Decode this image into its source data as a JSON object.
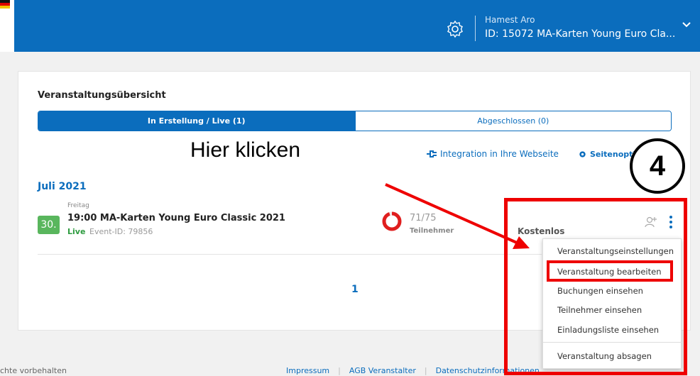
{
  "header": {
    "user_name": "Hamest Aro",
    "event_line": "ID: 15072  MA-Karten Young Euro Cla...",
    "settings_icon": "gear-icon",
    "expand_icon": "chevron-down-icon",
    "color": "#0b6dbd"
  },
  "main": {
    "title": "Veranstaltungsübersicht",
    "tabs": [
      {
        "label": "In Erstellung / Live (1)",
        "active": true
      },
      {
        "label": "Abgeschlossen (0)",
        "active": false
      }
    ],
    "integration_link": "Integration in Ihre Webseite",
    "page_options": "Seitenoptionen ▼",
    "month": "Juli 2021",
    "event": {
      "weekday": "Freitag",
      "day": "30.",
      "title": "19:00 MA-Karten Young Euro Classic 2021",
      "status": "Live",
      "event_id": "Event-ID: 79856",
      "count": "71/75",
      "count_label": "Teilnehmer",
      "filled": 71,
      "capacity": 75,
      "price": "Kostenlos"
    },
    "pagination": "1"
  },
  "menu": {
    "items": [
      "Veranstaltungseinstellungen",
      "Veranstaltung bearbeiten",
      "Buchungen einsehen",
      "Teilnehmer einsehen",
      "Einladungsliste einsehen",
      "Veranstaltung absagen"
    ]
  },
  "annotation": {
    "hint": "Hier klicken",
    "step": "4",
    "color": "#e00000"
  },
  "footer": {
    "left": "chte vorbehalten",
    "links": [
      "Impressum",
      "AGB Veranstalter",
      "Datenschutzinformationen"
    ],
    "separator": "|"
  }
}
